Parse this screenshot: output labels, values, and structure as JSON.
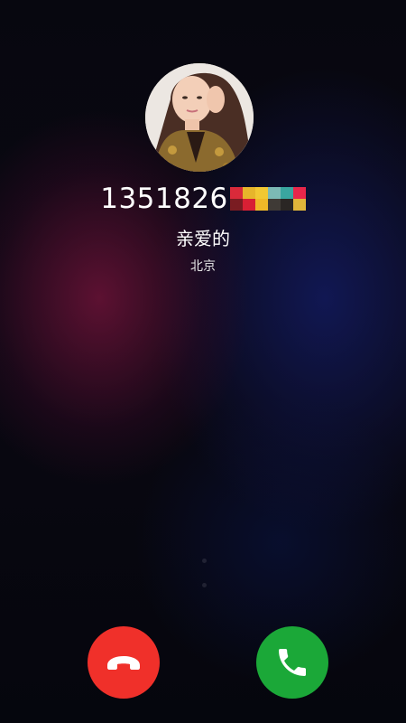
{
  "caller": {
    "number": "1351826",
    "name": "亲爱的",
    "location": "北京"
  },
  "mosaic_colors": [
    "#d92a3a",
    "#e7b52b",
    "#f2c833",
    "#7cb9b5",
    "#3aa6a0",
    "#e8264a",
    "#7a1c22",
    "#d82034",
    "#f0b828",
    "#3f3a36",
    "#2a2624",
    "#e0b53a"
  ],
  "buttons": {
    "decline_color": "#f0302a",
    "accept_color": "#1ba838",
    "decline_icon": "hang-up-icon",
    "accept_icon": "phone-icon"
  }
}
